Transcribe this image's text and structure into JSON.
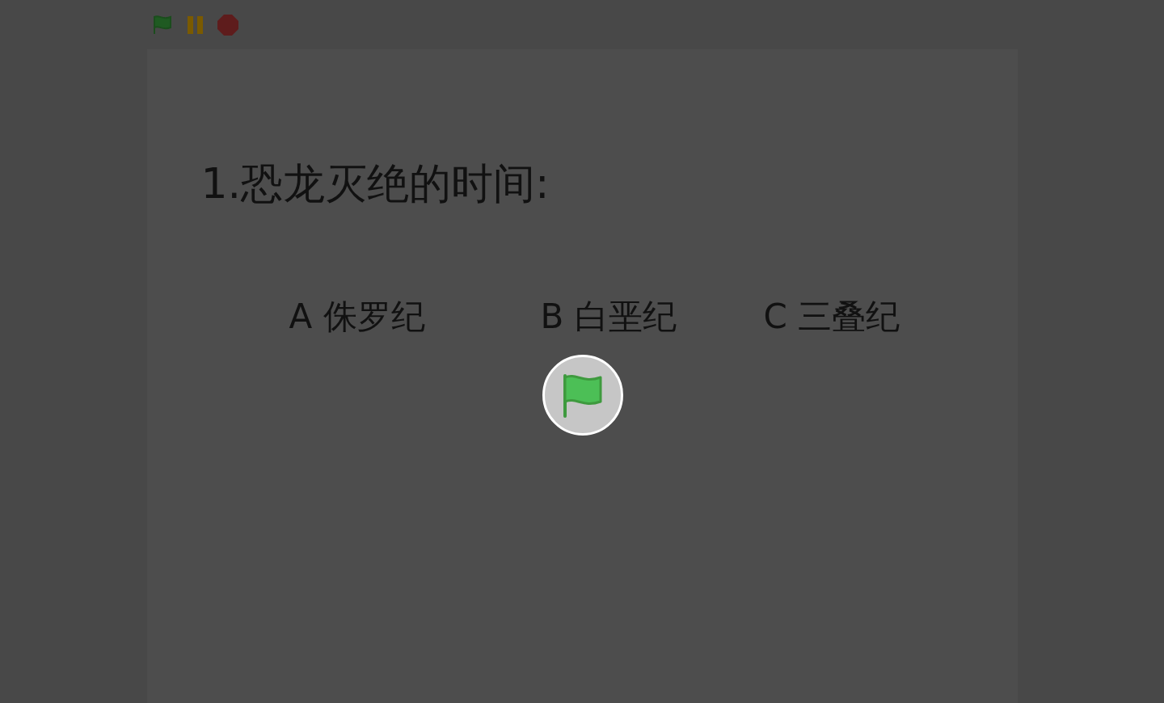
{
  "toolbar": {
    "buttons": [
      {
        "kind": "flag"
      },
      {
        "kind": "pause"
      },
      {
        "kind": "stop"
      }
    ]
  },
  "question": {
    "title": "1.恐龙灭绝的时间:",
    "options": [
      {
        "label": "A 侏罗纪"
      },
      {
        "label": "B 白垩纪"
      },
      {
        "label": "C 三叠纪"
      }
    ]
  },
  "overlay": {
    "kind": "flag"
  }
}
